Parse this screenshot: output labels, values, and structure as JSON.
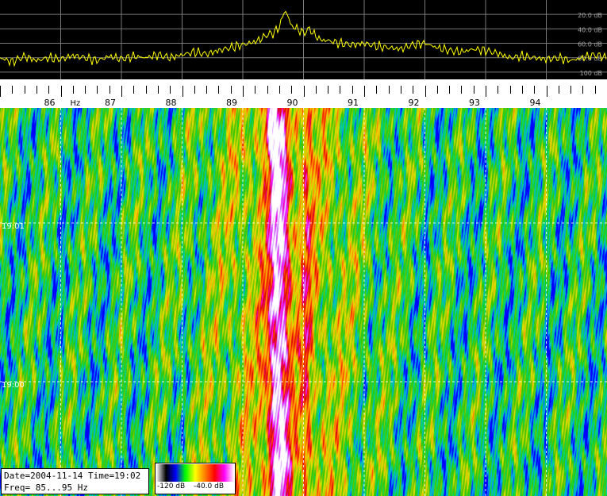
{
  "chart_data": [
    {
      "type": "line",
      "title": "",
      "xlabel": "",
      "ylabel": "",
      "xlim": [
        85.0,
        95.0
      ],
      "ylim": [
        -110,
        0
      ],
      "y_ticks": [
        {
          "value": -20,
          "label": "20.0 dB"
        },
        {
          "value": -40,
          "label": "40.0 dB"
        },
        {
          "value": -60,
          "label": "60.0 dB"
        },
        {
          "value": -80,
          "label": "80.0 dB"
        },
        {
          "value": -100,
          "label": "100 dB"
        }
      ],
      "series": [
        {
          "x": [
            85.0,
            85.2,
            85.4,
            85.6,
            85.8,
            86.0,
            86.2,
            86.4,
            86.6,
            86.8,
            87.0,
            87.2,
            87.4,
            87.6,
            87.8,
            88.0,
            88.2,
            88.4,
            88.6,
            88.8,
            89.0,
            89.1,
            89.2,
            89.3,
            89.4,
            89.5,
            89.6,
            89.65,
            89.7,
            89.75,
            89.8,
            89.9,
            90.0,
            90.1,
            90.2,
            90.3,
            90.4,
            90.6,
            90.8,
            91.0,
            91.2,
            91.4,
            91.6,
            91.8,
            92.0,
            92.2,
            92.4,
            92.6,
            92.8,
            93.0,
            93.2,
            93.4,
            93.6,
            93.8,
            94.0,
            94.2,
            94.4,
            94.6,
            94.8,
            95.0
          ],
          "y": [
            -80,
            -86,
            -78,
            -84,
            -80,
            -82,
            -77,
            -80,
            -84,
            -78,
            -82,
            -78,
            -80,
            -76,
            -80,
            -76,
            -72,
            -75,
            -70,
            -66,
            -62,
            -60,
            -58,
            -54,
            -48,
            -46,
            -38,
            -24,
            -14,
            -24,
            -36,
            -40,
            -46,
            -40,
            -50,
            -56,
            -56,
            -60,
            -62,
            -60,
            -64,
            -66,
            -68,
            -62,
            -60,
            -66,
            -70,
            -72,
            -68,
            -70,
            -74,
            -80,
            -78,
            -80,
            -82,
            -80,
            -84,
            -80,
            -76,
            -80
          ]
        }
      ],
      "color": "#ffff00",
      "grid": true
    },
    {
      "type": "heatmap",
      "title": "",
      "xlabel": "",
      "ylabel": "",
      "xlim": [
        85.0,
        95.0
      ],
      "x_unit_label": "Hz",
      "x_ticks": [
        86,
        87,
        88,
        89,
        90,
        91,
        92,
        93,
        94
      ],
      "y_ticks": [
        "19:01",
        "19:00"
      ],
      "grid": true,
      "signal_track": {
        "y_fraction": [
          0.0,
          0.1,
          0.2,
          0.3,
          0.4,
          0.5,
          0.6,
          0.7,
          0.8,
          0.9,
          1.0
        ],
        "center_freq": [
          89.48,
          89.55,
          89.6,
          89.58,
          89.62,
          89.56,
          89.6,
          89.55,
          89.58,
          89.6,
          89.57
        ]
      },
      "secondary_track_freq": 90.05,
      "colorbar": {
        "min_label": "-120 dB",
        "max_label": "-40.0 dB",
        "colors": [
          "#ffffff",
          "#000000",
          "#0000ff",
          "#00ff00",
          "#ffff00",
          "#ff8000",
          "#ff0000",
          "#ff00ff",
          "#ffffff"
        ]
      }
    }
  ],
  "info": {
    "date_time": "Date=2004-11-14 Time=19:02",
    "freq_range": "Freq= 85...95 Hz"
  }
}
